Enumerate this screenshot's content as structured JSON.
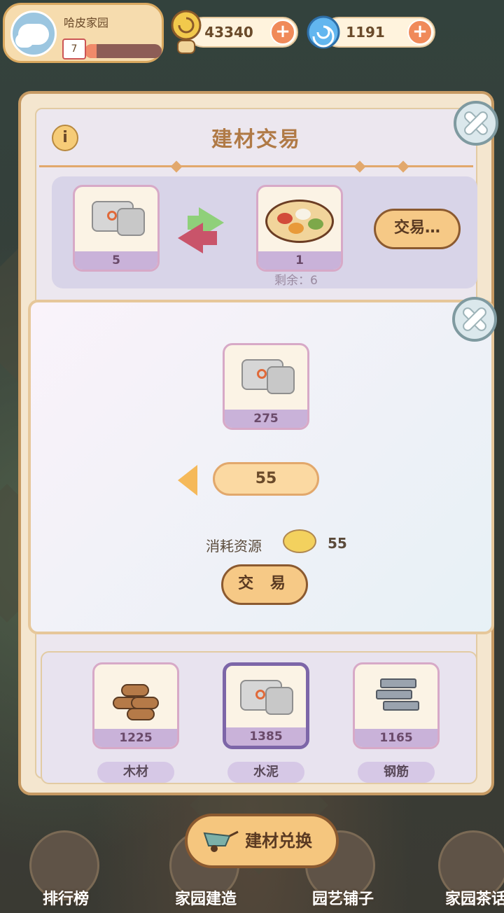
{
  "profile": {
    "name": "哈皮家园",
    "level": "7",
    "level_progress": 0.15
  },
  "resources": [
    {
      "icon": "snail-coin-icon",
      "value": "43340"
    },
    {
      "icon": "blue-swirl-gem-icon",
      "value": "1191"
    }
  ],
  "modal": {
    "title": "建材交易",
    "offer": {
      "give_icon": "cement-bag-icon",
      "give_count": "5",
      "get_icon": "food-platter-icon",
      "get_count": "1",
      "remaining": "剩余：6"
    },
    "trade_button": "交易…"
  },
  "popup": {
    "item_icon": "cement-bag-icon",
    "item_count": "275",
    "quantity": "55",
    "cost_label": "消耗资源",
    "cost_icon": "food-bowl-icon",
    "cost_value": "55",
    "trade_button": "交 易"
  },
  "materials": [
    {
      "name": "木材",
      "count": "1225",
      "icon": "wood-logs-icon",
      "selected": false
    },
    {
      "name": "水泥",
      "count": "1385",
      "icon": "cement-bag-icon",
      "selected": true
    },
    {
      "name": "钢筋",
      "count": "1165",
      "icon": "steel-bars-icon",
      "selected": false
    }
  ],
  "bottom_nav": [
    {
      "label": "排行榜",
      "icon": "leaderboard-icon"
    },
    {
      "label": "家园建造",
      "icon": "home-build-icon"
    },
    {
      "label": "园艺铺子",
      "icon": "garden-shop-icon"
    },
    {
      "label": "家园茶话",
      "icon": "chat-icon"
    }
  ],
  "center_button": {
    "label": "建材兑换",
    "icon": "wheelbarrow-icon"
  },
  "colors": {
    "accent": "#f6c986",
    "panel": "#f4e6cf",
    "selected": "#7d66a8"
  }
}
